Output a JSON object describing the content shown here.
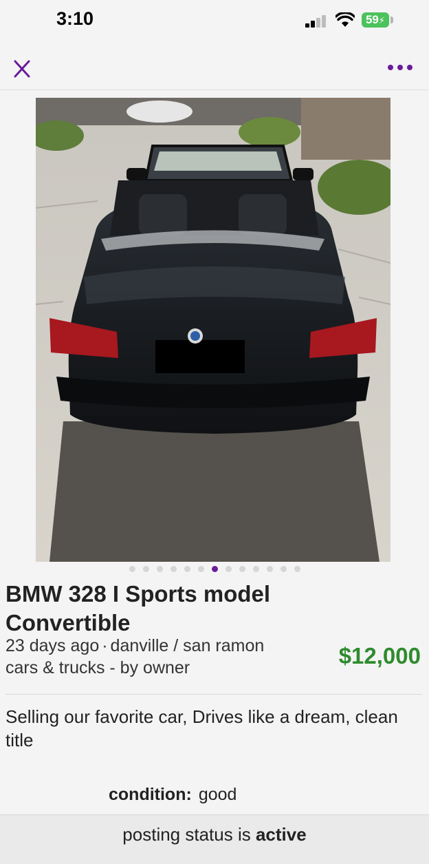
{
  "status_bar": {
    "time": "3:10",
    "battery": "59",
    "battery_color": "#4cc25c"
  },
  "nav": {
    "close_icon": "close-x-icon",
    "more_icon": "ellipsis-icon",
    "accent_color": "#6a1b9a"
  },
  "gallery": {
    "image_count": 13,
    "active_index": 6,
    "photo_subject": "black convertible car rear view, photo 7 of 13"
  },
  "listing": {
    "title": "BMW 328 I Sports model Convertible",
    "posted": "23 days ago",
    "location": "danville / san ramon",
    "category": "cars & trucks - by owner",
    "price": "$12,000",
    "price_color": "#2e8b2e",
    "description": "Selling our favorite car, Drives like a dream, clean title",
    "attributes": [
      {
        "key": "condition:",
        "value": "good"
      }
    ]
  },
  "footer": {
    "status_prefix": "posting status is",
    "status_value": "active"
  }
}
